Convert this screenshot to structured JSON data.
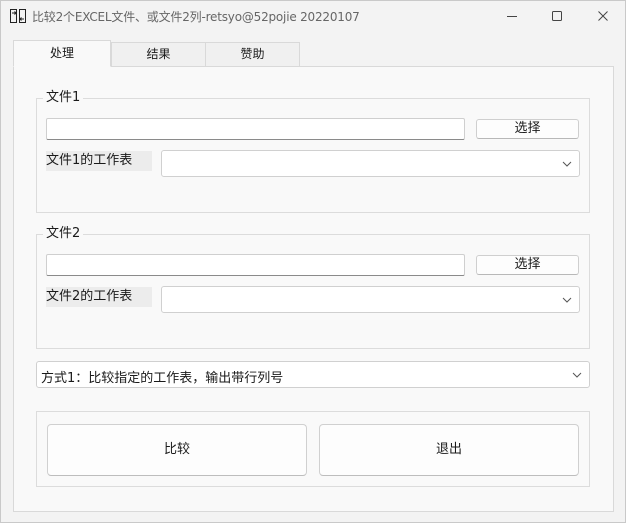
{
  "window": {
    "title": "比较2个EXCEL文件、或文件2列-retsyo@52pojie     20220107"
  },
  "tabs": [
    {
      "label": "处理",
      "active": true
    },
    {
      "label": "结果",
      "active": false
    },
    {
      "label": "赞助",
      "active": false
    }
  ],
  "file1": {
    "group_label": "文件1",
    "path_value": "",
    "pick_label": "选择",
    "sheet_label": "文件1的工作表",
    "sheet_value": ""
  },
  "file2": {
    "group_label": "文件2",
    "path_value": "",
    "pick_label": "选择",
    "sheet_label": "文件2的工作表",
    "sheet_value": ""
  },
  "mode": {
    "selected": "方式1：比较指定的工作表，输出带行列号"
  },
  "actions": {
    "compare_label": "比较",
    "exit_label": "退出"
  }
}
